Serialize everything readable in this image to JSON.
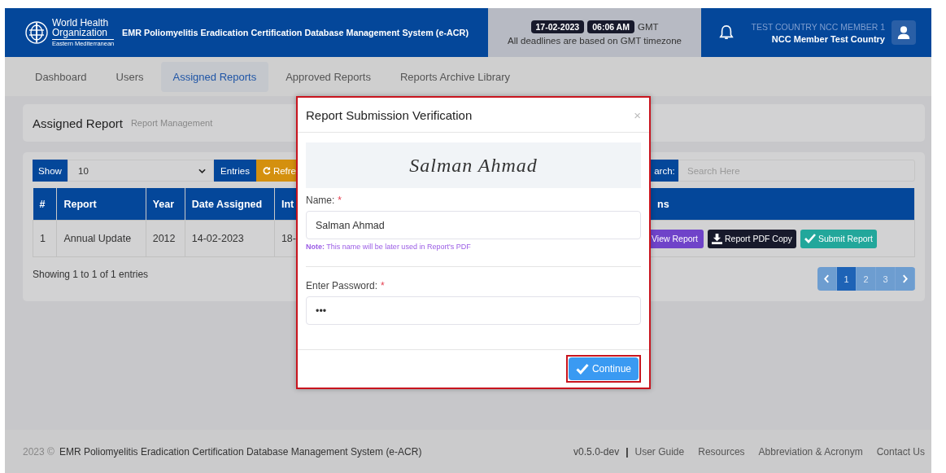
{
  "header": {
    "logo": {
      "line1": "World Health",
      "line2": "Organization",
      "region": "Eastern Mediterranean"
    },
    "system_title": "EMR Poliomyelitis Eradication Certification Database Management System (e-ACR)",
    "date": "17-02-2023",
    "time": "06:06 AM",
    "timezone": "GMT",
    "deadline_note": "All deadlines are based on GMT timezone",
    "user_role": "TEST COUNTRY NCC MEMBER 1",
    "user_name": "NCC Member Test Country"
  },
  "nav": [
    {
      "label": "Dashboard",
      "selected": false
    },
    {
      "label": "Users",
      "selected": false
    },
    {
      "label": "Assigned Reports",
      "selected": true
    },
    {
      "label": "Approved Reports",
      "selected": false
    },
    {
      "label": "Reports Archive Library",
      "selected": false
    }
  ],
  "page": {
    "title": "Assigned Report",
    "subtitle": "Report Management"
  },
  "toolbar": {
    "show_label": "Show",
    "page_size": "10",
    "entries_label": "Entries",
    "refresh_label": "Refre",
    "search_label": "arch:",
    "search_placeholder": "Search Here"
  },
  "table": {
    "columns_left": [
      "#",
      "Report",
      "Year",
      "Date Assigned",
      "Int"
    ],
    "column_right": "ns",
    "rows": [
      {
        "cells": [
          "1",
          "Annual Update",
          "2012",
          "14-02-2023",
          "18-"
        ],
        "actions": [
          {
            "kind": "view",
            "label": "View Report"
          },
          {
            "kind": "download",
            "label": "Report PDF Copy"
          },
          {
            "kind": "submit",
            "label": "Submit Report"
          }
        ]
      }
    ]
  },
  "showing": "Showing 1 to 1 of 1 entries",
  "pagination": [
    {
      "label": "1",
      "selected": true
    },
    {
      "label": "2",
      "selected": false
    },
    {
      "label": "3",
      "selected": false
    }
  ],
  "modal": {
    "title": "Report Submission Verification",
    "close": "×",
    "highlighted": true,
    "signature": "Salman Ahmad",
    "name_label": "Name:",
    "required_mark": "*",
    "name_value": "Salman Ahmad",
    "note": "**Note:** This name will be later used in Report's PDF",
    "password_label": "Enter Password:",
    "password_value": "•••",
    "continue": {
      "label": "Continue",
      "highlighted": true
    }
  },
  "footer": {
    "year": "2023 ©",
    "title": "EMR Poliomyelitis Eradication Certification Database Management System (e-ACR)",
    "version": "v0.5.0-dev",
    "separator": "|",
    "links": [
      "User Guide",
      "Resources",
      "Abbreviation & Acronym",
      "Contact Us"
    ]
  }
}
